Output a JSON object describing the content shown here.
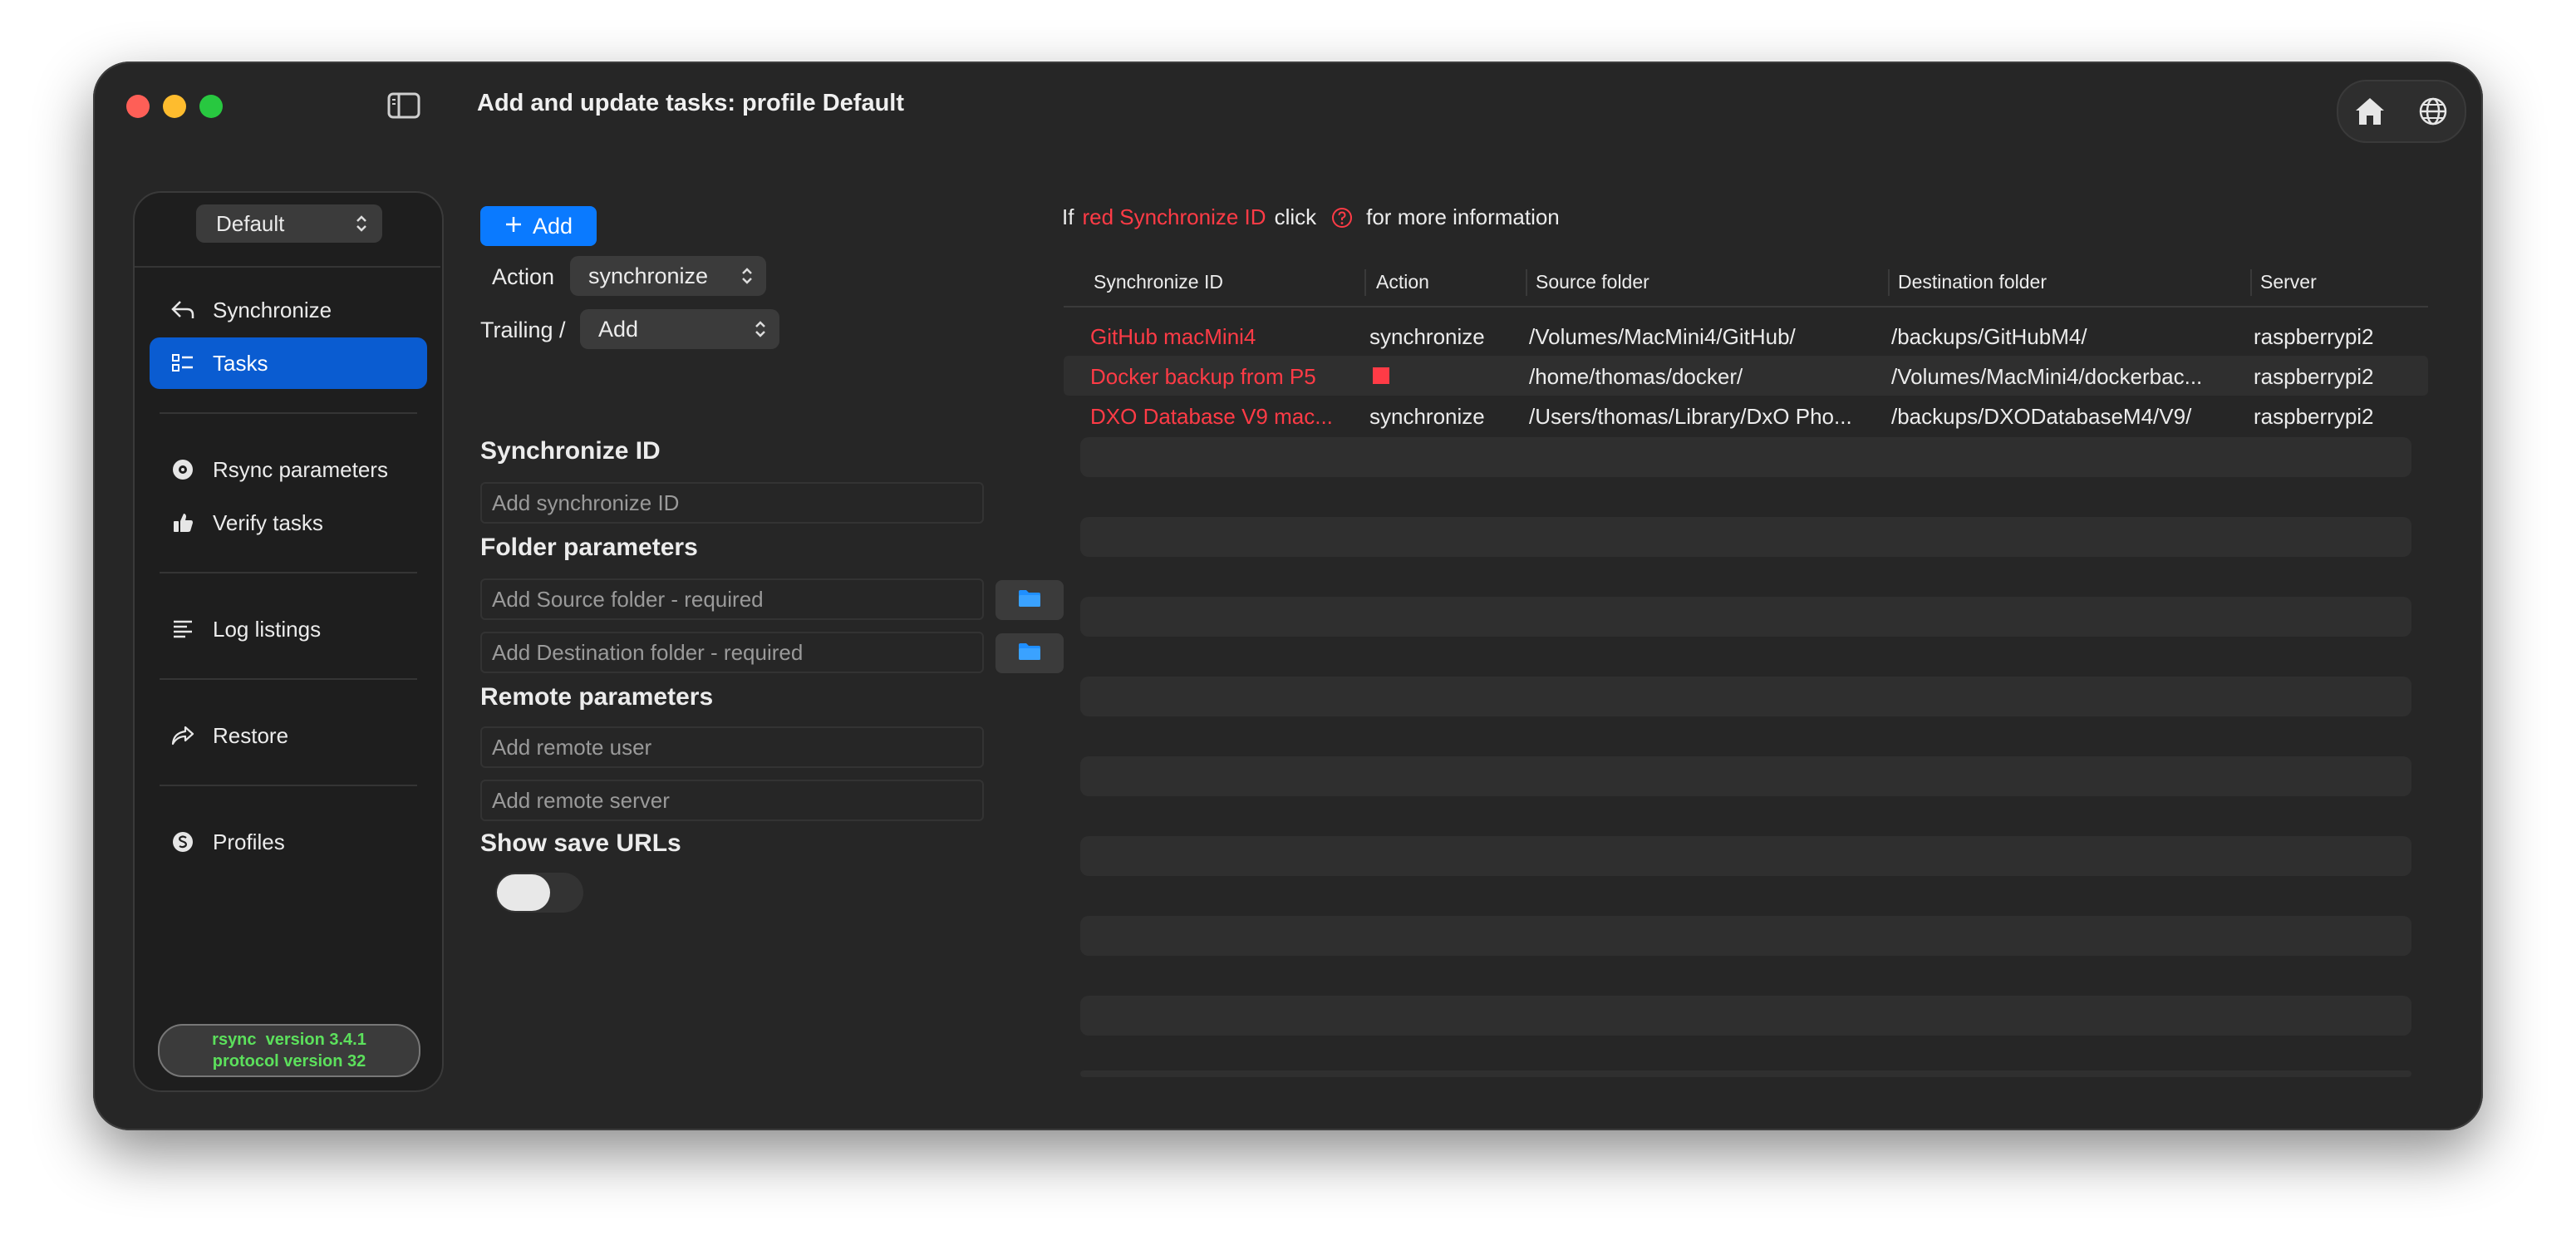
{
  "window": {
    "title": "Add and update tasks: profile Default"
  },
  "sidebar": {
    "profile": "Default",
    "items": [
      {
        "label": "Synchronize",
        "icon": "arrow-uturn-icon",
        "active": false
      },
      {
        "label": "Tasks",
        "icon": "checklist-icon",
        "active": true
      },
      {
        "label": "Rsync parameters",
        "icon": "gear-badge-icon",
        "active": false
      },
      {
        "label": "Verify tasks",
        "icon": "thumbs-up-icon",
        "active": false
      },
      {
        "label": "Log listings",
        "icon": "text-lines-icon",
        "active": false
      },
      {
        "label": "Restore",
        "icon": "share-arrow-icon",
        "active": false
      },
      {
        "label": "Profiles",
        "icon": "dollar-circle-icon",
        "active": false
      }
    ],
    "rsync_version": "rsync  version 3.4.1",
    "protocol_version": "protocol version 32"
  },
  "form": {
    "add_label": "Add",
    "action_label": "Action",
    "action_value": "synchronize",
    "trailing_label": "Trailing /",
    "trailing_value": "Add",
    "sync_id_title": "Synchronize ID",
    "sync_id_placeholder": "Add synchronize ID",
    "folder_title": "Folder parameters",
    "source_placeholder": "Add Source folder - required",
    "dest_placeholder": "Add Destination folder - required",
    "remote_title": "Remote parameters",
    "remote_user_placeholder": "Add remote user",
    "remote_server_placeholder": "Add remote server",
    "show_urls_title": "Show save URLs",
    "show_urls_on": false
  },
  "info": {
    "prefix": "If",
    "red_text": "red Synchronize ID",
    "middle": "click",
    "suffix": "for more information"
  },
  "table": {
    "headers": [
      "Synchronize ID",
      "Action",
      "Source folder",
      "Destination folder",
      "Server"
    ],
    "rows": [
      {
        "id": "GitHub macMini4",
        "action": "synchronize",
        "source": "/Volumes/MacMini4/GitHub/",
        "dest": "/backups/GitHubM4/",
        "server": "raspberrypi2"
      },
      {
        "id": "Docker backup from P5",
        "action": "",
        "source": "/home/thomas/docker/",
        "dest": "/Volumes/MacMini4/dockerbac...",
        "server": "raspberrypi2"
      },
      {
        "id": "DXO Database V9 mac...",
        "action": "synchronize",
        "source": "/Users/thomas/Library/DxO Pho...",
        "dest": "/backups/DXODatabaseM4/V9/",
        "server": "raspberrypi2"
      }
    ]
  },
  "colors": {
    "accent": "#0a5cd1",
    "button_blue": "#0a7aff",
    "red": "#ff3b46",
    "rsync_green": "#5ce05c"
  }
}
